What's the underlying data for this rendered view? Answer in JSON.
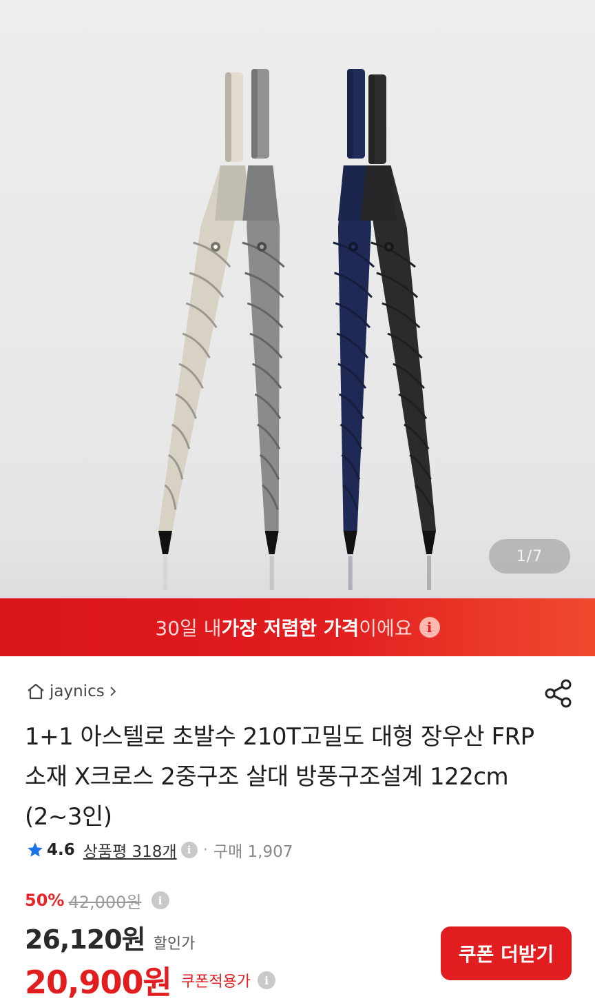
{
  "gallery": {
    "counter": "1/7",
    "umbrella_colors": [
      "#d8d2c5",
      "#8a8b8d",
      "#1e2a55",
      "#2b2b2d"
    ]
  },
  "banner": {
    "prefix": "30일 내 ",
    "highlight": "가장 저렴한 가격",
    "suffix": "이에요"
  },
  "store": {
    "name": "jaynics"
  },
  "product": {
    "title": "1+1 아스텔로 초발수 210T고밀도 대형 장우산 FRP소재 X크로스 2중구조 살대 방풍구조설계 122cm (2~3인)"
  },
  "rating": {
    "score": "4.6",
    "reviews": "상품평 318개",
    "sold": "구매 1,907"
  },
  "pricing": {
    "discount": "50%",
    "original": "42,000원",
    "sale_price": "26,120원",
    "sale_label": "할인가",
    "coupon_price": "20,900원",
    "coupon_label": "쿠폰적용가"
  },
  "actions": {
    "coupon_button": "쿠폰 더받기"
  },
  "colors": {
    "accent": "#e21d1f"
  }
}
